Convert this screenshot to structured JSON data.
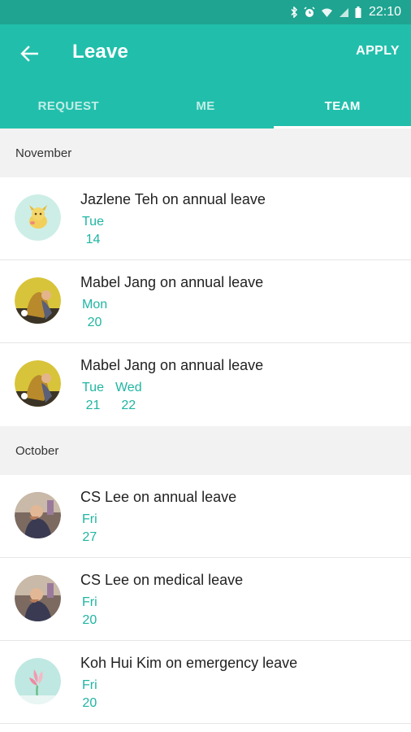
{
  "status_bar": {
    "time": "22:10"
  },
  "app_bar": {
    "title": "Leave",
    "apply_label": "APPLY"
  },
  "tabs": [
    {
      "label": "REQUEST",
      "active": false
    },
    {
      "label": "ME",
      "active": false
    },
    {
      "label": "TEAM",
      "active": true
    }
  ],
  "colors": {
    "primary": "#21bfab",
    "status_bar": "#1fa491",
    "accent_text": "#1fb5a2",
    "section_bg": "#f2f2f2"
  },
  "sections": [
    {
      "header": "November",
      "items": [
        {
          "title": "Jazlene Teh on annual leave",
          "avatar": "avatar-cartoon-mint",
          "dates": [
            {
              "day": "Tue",
              "num": "14"
            }
          ]
        },
        {
          "title": "Mabel Jang on annual leave",
          "avatar": "avatar-photo-yellow",
          "dates": [
            {
              "day": "Mon",
              "num": "20"
            }
          ]
        },
        {
          "title": "Mabel Jang on annual leave",
          "avatar": "avatar-photo-yellow",
          "dates": [
            {
              "day": "Tue",
              "num": "21"
            },
            {
              "day": "Wed",
              "num": "22"
            }
          ]
        }
      ]
    },
    {
      "header": "October",
      "items": [
        {
          "title": "CS Lee on annual leave",
          "avatar": "avatar-photo-dark",
          "dates": [
            {
              "day": "Fri",
              "num": "27"
            }
          ]
        },
        {
          "title": "CS Lee on medical leave",
          "avatar": "avatar-photo-dark",
          "dates": [
            {
              "day": "Fri",
              "num": "20"
            }
          ]
        },
        {
          "title": "Koh Hui Kim on emergency leave",
          "avatar": "avatar-flower-pink",
          "dates": [
            {
              "day": "Fri",
              "num": "20"
            }
          ]
        }
      ]
    }
  ]
}
